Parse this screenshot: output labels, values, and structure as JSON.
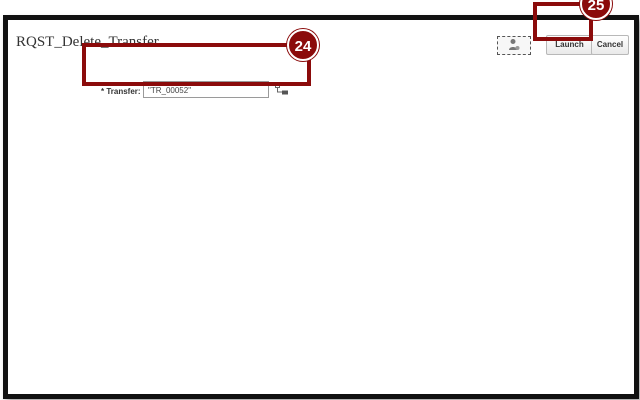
{
  "dialog": {
    "title": "RQST_Delete_Transfer"
  },
  "toolbar": {
    "launch_label": "Launch",
    "cancel_label": "Cancel",
    "user_icon": "user-settings-icon"
  },
  "form": {
    "transfer": {
      "label": "* Transfer:",
      "value": "\"TR_00052\"",
      "lookup_icon": "hierarchy-lookup-icon"
    }
  },
  "callouts": [
    {
      "number": "24",
      "target": "transfer-field"
    },
    {
      "number": "25",
      "target": "launch-button"
    }
  ],
  "colors": {
    "callout": "#8b0b0b",
    "frame_border": "#111111"
  }
}
